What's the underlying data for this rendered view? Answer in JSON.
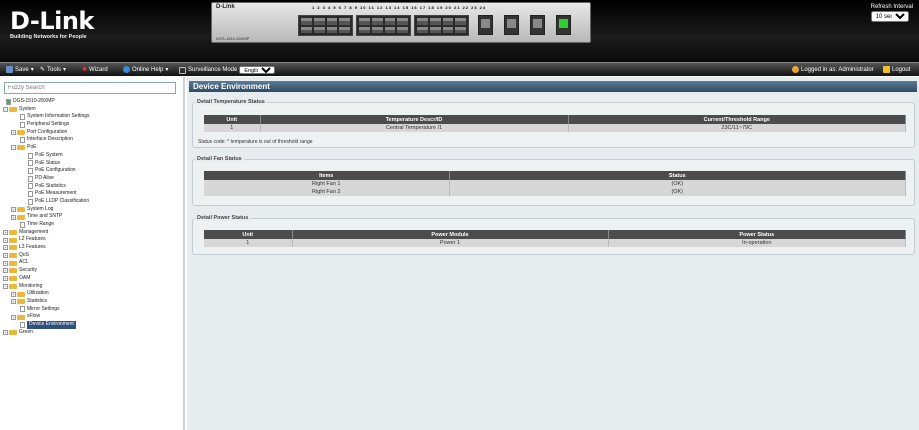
{
  "header": {
    "logo_name": "D-Link",
    "logo_tagline": "Building Networks for People",
    "device_brand": "D-Link",
    "device_model": "DGS-1510-28XMP",
    "port_numbers_text": "1 2 3 4 5 6 7 8  9 10 11 12 13 14 15 16  17 18 19 20 21 22 23 24",
    "refresh_label": "Refresh Interval",
    "refresh_value": "10 secs",
    "accent_color": "#2e4b63"
  },
  "toolbar": {
    "save_label": "Save",
    "tools_label": "Tools",
    "wizard_label": "Wizard",
    "online_help_label": "Online Help",
    "surveillance_label": "Surveillance Mode",
    "language_value": "English",
    "logged_in_label": "Logged in as: Administrator",
    "logout_label": "Logout"
  },
  "sidebar": {
    "search_placeholder": "Fuzzy Search",
    "tree": [
      {
        "label": "DGS-1510-28XMP"
      },
      {
        "label": "System"
      },
      {
        "label": "System Information Settings"
      },
      {
        "label": "Peripheral Settings"
      },
      {
        "label": "Port Configuration"
      },
      {
        "label": "Interface Description"
      },
      {
        "label": "PoE"
      },
      {
        "label": "PoE System"
      },
      {
        "label": "PoE Status"
      },
      {
        "label": "PoE Configuration"
      },
      {
        "label": "PD Alive"
      },
      {
        "label": "PoE Statistics"
      },
      {
        "label": "PoE Measurement"
      },
      {
        "label": "PoE LLDP Classification"
      },
      {
        "label": "System Log"
      },
      {
        "label": "Time and SNTP"
      },
      {
        "label": "Time Range"
      },
      {
        "label": "Management"
      },
      {
        "label": "L2 Features"
      },
      {
        "label": "L3 Features"
      },
      {
        "label": "QoS"
      },
      {
        "label": "ACL"
      },
      {
        "label": "Security"
      },
      {
        "label": "OAM"
      },
      {
        "label": "Monitoring"
      },
      {
        "label": "Utilization"
      },
      {
        "label": "Statistics"
      },
      {
        "label": "Mirror Settings"
      },
      {
        "label": "sFlow"
      },
      {
        "label": "Device Environment"
      },
      {
        "label": "Green"
      }
    ]
  },
  "main": {
    "title": "Device Environment",
    "temperature": {
      "section_title": "Detail Temperature Status",
      "headers": [
        "Unit",
        "Temperature Descr/ID",
        "Current/Threshold Range"
      ],
      "rows": [
        [
          "1",
          "Central Temperature /1",
          "23C/11~79C"
        ]
      ],
      "note": "Status code: * temperature is out of threshold range"
    },
    "fan": {
      "section_title": "Detail Fan Status",
      "headers": [
        "Items",
        "Status"
      ],
      "rows": [
        [
          "Right Fan 1",
          "(OK)"
        ],
        [
          "Right Fan 2",
          "(OK)"
        ]
      ]
    },
    "power": {
      "section_title": "Detail Power Status",
      "headers": [
        "Unit",
        "Power Module",
        "Power Status"
      ],
      "rows": [
        [
          "1",
          "Power 1",
          "In-operation"
        ]
      ]
    }
  }
}
